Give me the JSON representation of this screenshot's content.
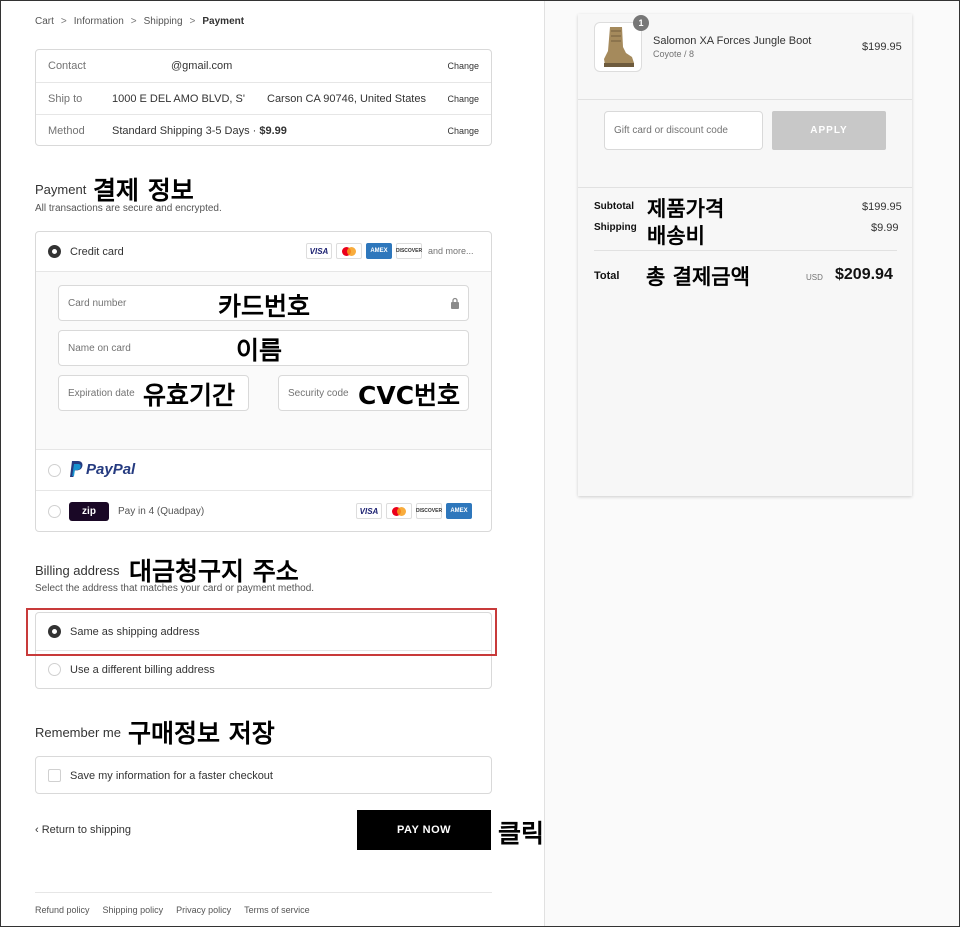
{
  "breadcrumb": {
    "items": [
      "Cart",
      "Information",
      "Shipping",
      "Payment"
    ]
  },
  "info": {
    "rows": [
      {
        "label": "Contact",
        "value": "@gmail.com",
        "change": "Change"
      },
      {
        "label": "Ship to",
        "value": "1000 E DEL AMO BLVD, S'",
        "value2": "Carson CA 90746, United States",
        "change": "Change"
      },
      {
        "label": "Method",
        "value": "Standard Shipping 3-5 Days · ",
        "price": "$9.99",
        "change": "Change"
      }
    ]
  },
  "payment": {
    "title": "Payment",
    "note_ko": "결제 정보",
    "subtitle": "All transactions are secure and encrypted.",
    "credit_card_label": "Credit card",
    "brands": [
      "VISA",
      "AMEX",
      "DISCOVER"
    ],
    "and_more": "and more...",
    "card_number_placeholder": "Card number",
    "card_number_ko": "카드번호",
    "name_placeholder": "Name on card",
    "name_ko": "이름",
    "expiration_placeholder": "Expiration date",
    "expiration_ko": "유효기간",
    "security_placeholder": "Security code",
    "security_ko": "CVC번호",
    "paypal_label": "PayPal",
    "zip_logo": "zip",
    "zip_label": "Pay in 4 (Quadpay)"
  },
  "billing": {
    "title": "Billing address",
    "note_ko": "대금청구지 주소",
    "subtitle": "Select the address that matches your card or payment method.",
    "same_label": "Same as shipping address",
    "different_label": "Use a different billing address"
  },
  "remember": {
    "title": "Remember me",
    "note_ko": "구매정보 저장",
    "save_label": "Save my information for a faster checkout"
  },
  "actions": {
    "return_label": "Return to shipping",
    "pay_label": "PAY NOW",
    "pay_note_ko": "클릭"
  },
  "footer": {
    "links": [
      "Refund policy",
      "Shipping policy",
      "Privacy policy",
      "Terms of service"
    ]
  },
  "summary": {
    "product": {
      "name": "Salomon XA Forces Jungle Boot",
      "variant": "Coyote / 8",
      "price": "$199.95",
      "qty": "1"
    },
    "gift_placeholder": "Gift card or discount code",
    "apply_label": "APPLY",
    "subtotal_label": "Subtotal",
    "subtotal_ko": "제품가격",
    "subtotal_value": "$199.95",
    "shipping_label": "Shipping",
    "shipping_ko": "배송비",
    "shipping_value": "$9.99",
    "total_label": "Total",
    "total_ko": "총 결제금액",
    "currency": "USD",
    "total_value": "$209.94"
  },
  "colors": {
    "accent": "#000000",
    "highlight": "#c83a3a",
    "paypal_dark": "#253b80",
    "paypal_light": "#179bd7"
  }
}
